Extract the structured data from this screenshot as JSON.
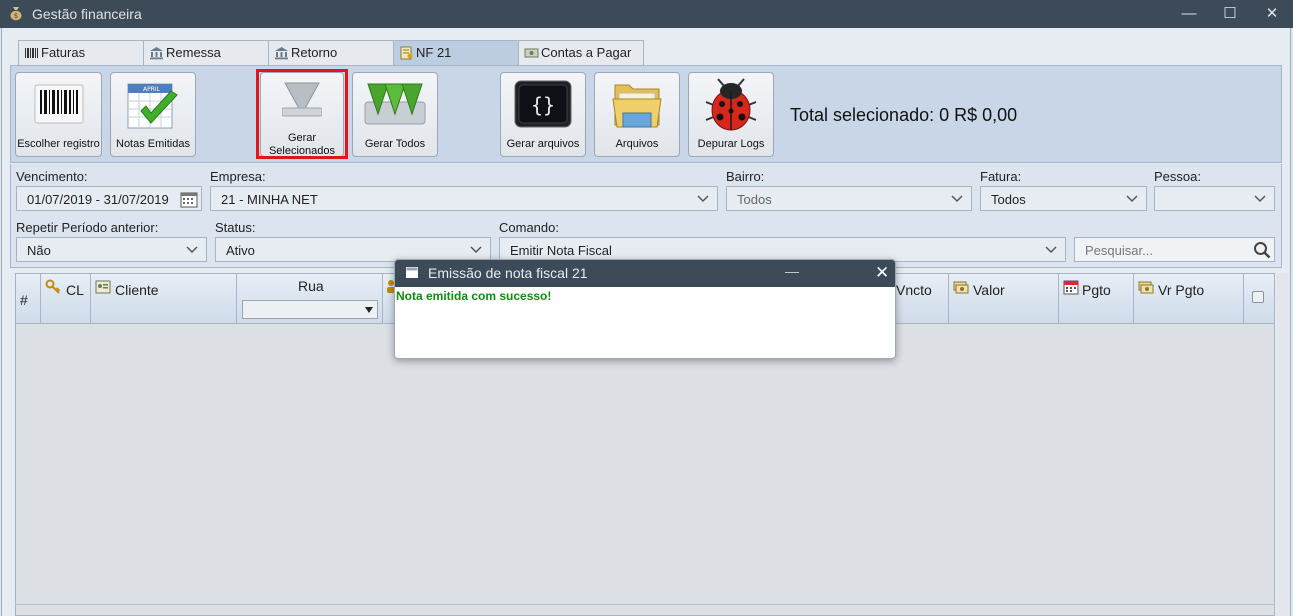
{
  "window": {
    "title": "Gestão financeira",
    "min": "—",
    "max": "☐",
    "close": "✕"
  },
  "tabs": [
    {
      "label": "Faturas",
      "icon": "barcode-icon"
    },
    {
      "label": "Remessa",
      "icon": "bank-icon"
    },
    {
      "label": "Retorno",
      "icon": "bank-icon"
    },
    {
      "label": "NF 21",
      "icon": "invoice-icon",
      "active": true
    },
    {
      "label": "Contas a Pagar",
      "icon": "money-icon"
    }
  ],
  "toolbar": {
    "choose_record": "Escolher registro",
    "issued_notes": "Notas Emitidas",
    "generate_selected_1": "Gerar",
    "generate_selected_2": "Selecionados",
    "generate_all": "Gerar Todos",
    "generate_files": "Gerar arquivos",
    "files": "Arquivos",
    "debug_logs": "Depurar Logs",
    "total_selected": "Total selecionado: 0 R$ 0,00"
  },
  "filters": {
    "vencimento_label": "Vencimento:",
    "vencimento_value": "01/07/2019 - 31/07/2019",
    "empresa_label": "Empresa:",
    "empresa_value": "21 - MINHA NET",
    "bairro_label": "Bairro:",
    "bairro_value": "Todos",
    "fatura_label": "Fatura:",
    "fatura_value": "Todos",
    "pessoa_label": "Pessoa:",
    "pessoa_value": "",
    "repetir_label": "Repetir Período anterior:",
    "repetir_value": "Não",
    "status_label": "Status:",
    "status_value": "Ativo",
    "comando_label": "Comando:",
    "comando_value": "Emitir Nota Fiscal",
    "search_placeholder": "Pesquisar..."
  },
  "grid": {
    "columns": {
      "num": "#",
      "cl": "CL",
      "cliente": "Cliente",
      "rua": "Rua",
      "vencto": "Vncto",
      "valor": "Valor",
      "pgto": "Pgto",
      "vr_pgto": "Vr Pgto"
    }
  },
  "dialog": {
    "title": "Emissão de nota fiscal 21",
    "minimize": "—",
    "close": "✕",
    "message": "Nota emitida com sucesso!"
  },
  "colors": {
    "titlebar": "#3d4a57",
    "toolbar_bg": "#c8d6e8",
    "highlight": "#e0161b",
    "success": "#128a12"
  }
}
